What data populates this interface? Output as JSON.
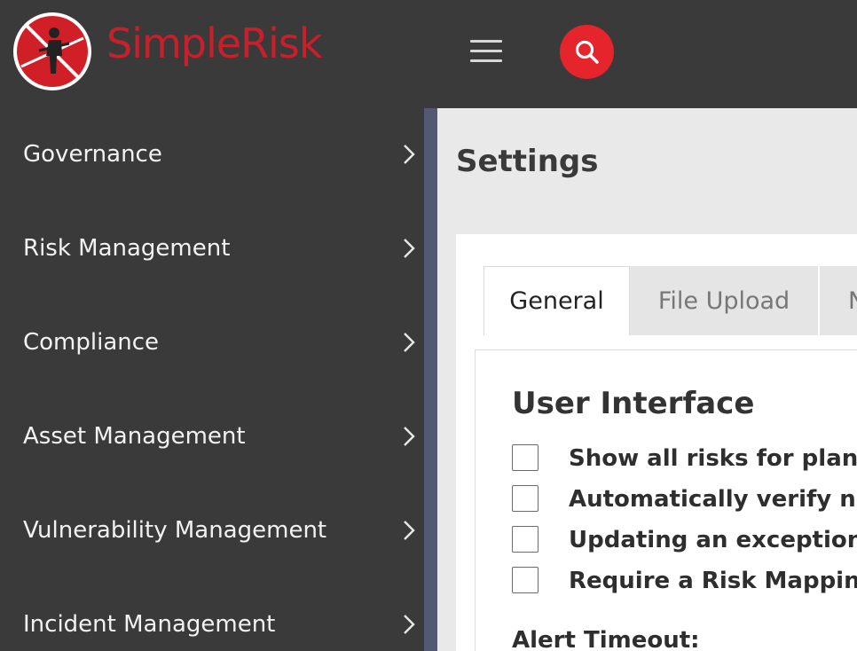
{
  "brand": {
    "name": "SimpleRisk",
    "color": "#c8202a"
  },
  "header": {
    "menu_icon": "hamburger-icon",
    "search_icon": "search-icon",
    "search_color": "#e5242b"
  },
  "sidebar": {
    "items": [
      {
        "label": "Governance"
      },
      {
        "label": "Risk Management"
      },
      {
        "label": "Compliance"
      },
      {
        "label": "Asset Management"
      },
      {
        "label": "Vulnerability Management"
      },
      {
        "label": "Incident Management"
      }
    ]
  },
  "main": {
    "title": "Settings",
    "tabs": [
      {
        "label": "General",
        "active": true
      },
      {
        "label": "File Upload",
        "active": false
      },
      {
        "label": "N",
        "active": false
      }
    ],
    "section_title": "User Interface",
    "options": [
      {
        "label": "Show all risks for planne",
        "checked": false
      },
      {
        "label": "Automatically verify new",
        "checked": false
      },
      {
        "label": "Updating an exception m",
        "checked": false
      },
      {
        "label": "Require a Risk Mapping f",
        "checked": false
      }
    ],
    "alert_timeout_label": "Alert Timeout:"
  }
}
